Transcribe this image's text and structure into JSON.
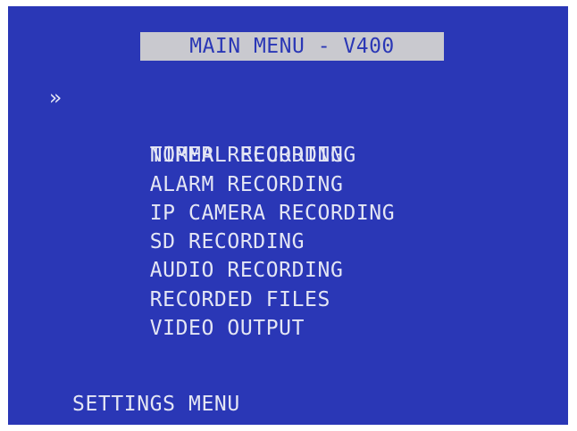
{
  "screen": {
    "title": "MAIN MENU - V400",
    "cursor_glyph": "»",
    "selected_index": 0,
    "colors": {
      "background": "#2a37b6",
      "title_bar": "#c9c9cf",
      "title_text": "#2a37b6",
      "menu_text": "#e4e6f4"
    }
  },
  "menu": {
    "items": [
      {
        "label": "NORMAL RECORDING"
      },
      {
        "label": "TIMER RECORDING"
      },
      {
        "label": "ALARM RECORDING"
      },
      {
        "label": "IP CAMERA RECORDING"
      },
      {
        "label": "SD RECORDING"
      },
      {
        "label": "AUDIO RECORDING"
      },
      {
        "label": "RECORDED FILES"
      },
      {
        "label": "VIDEO OUTPUT"
      }
    ]
  },
  "footer": {
    "settings_label": "SETTINGS MENU"
  }
}
